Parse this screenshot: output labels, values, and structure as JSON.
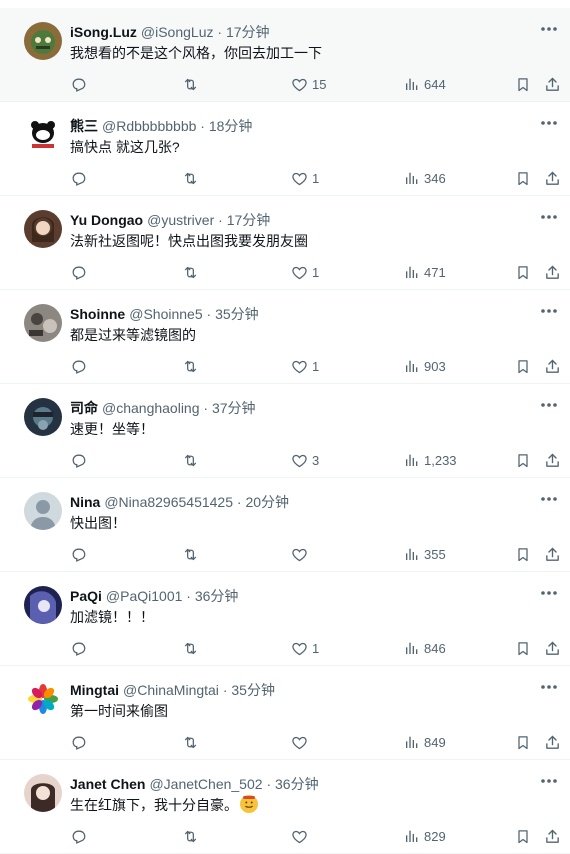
{
  "tweets": [
    {
      "name": "iSong.Luz",
      "handle": "@iSongLuz",
      "sep": "·",
      "time": "17分钟",
      "text": "我想看的不是这个风格，你回去加工一下",
      "likes": "15",
      "views": "644",
      "avatar_color": "#7a5c2e"
    },
    {
      "name": "熊三",
      "handle": "@Rdbbbbbbbb",
      "sep": "·",
      "time": "18分钟",
      "text": "搞快点 就这几张?",
      "likes": "1",
      "views": "346",
      "avatar_color": "#ffffff"
    },
    {
      "name": "Yu Dongao",
      "handle": "@yustriver",
      "sep": "·",
      "time": "17分钟",
      "text": "法新社返图呢！快点出图我要发朋友圈",
      "likes": "1",
      "views": "471",
      "avatar_color": "#c9a48a"
    },
    {
      "name": "Shoinne",
      "handle": "@Shoinne5",
      "sep": "·",
      "time": "35分钟",
      "text": "都是过来等滤镜图的",
      "likes": "1",
      "views": "903",
      "avatar_color": "#6f6a66"
    },
    {
      "name": "司命",
      "handle": "@changhaoling",
      "sep": "·",
      "time": "37分钟",
      "text": "速更！坐等！",
      "likes": "3",
      "views": "1,233",
      "avatar_color": "#2f3b4a"
    },
    {
      "name": "Nina",
      "handle": "@Nina82965451425",
      "sep": "·",
      "time": "20分钟",
      "text": "快出图！",
      "likes": "",
      "views": "355",
      "avatar_color": "#cfd9de"
    },
    {
      "name": "PaQi",
      "handle": "@PaQi1001",
      "sep": "·",
      "time": "36分钟",
      "text": "加滤镜！！！",
      "likes": "1",
      "views": "846",
      "avatar_color": "#3a3f7a"
    },
    {
      "name": "Mingtai",
      "handle": "@ChinaMingtai",
      "sep": "·",
      "time": "35分钟",
      "text": "第一时间来偷图",
      "likes": "",
      "views": "849",
      "avatar_color": "#ffffff"
    },
    {
      "name": "Janet Chen",
      "handle": "@JanetChen_502",
      "sep": "·",
      "time": "36分钟",
      "text": "生在红旗下，我十分自豪。",
      "likes": "",
      "views": "829",
      "avatar_color": "#e8d6cf",
      "emoji": "smiling-face-emoji"
    }
  ],
  "colors": {
    "text": "#0f1419",
    "muted": "#536471",
    "border": "#eff3f4",
    "hover": "#f7f9f9"
  },
  "icons": [
    "reply-icon",
    "retweet-icon",
    "like-icon",
    "views-icon",
    "bookmark-icon",
    "share-icon",
    "more-icon"
  ]
}
